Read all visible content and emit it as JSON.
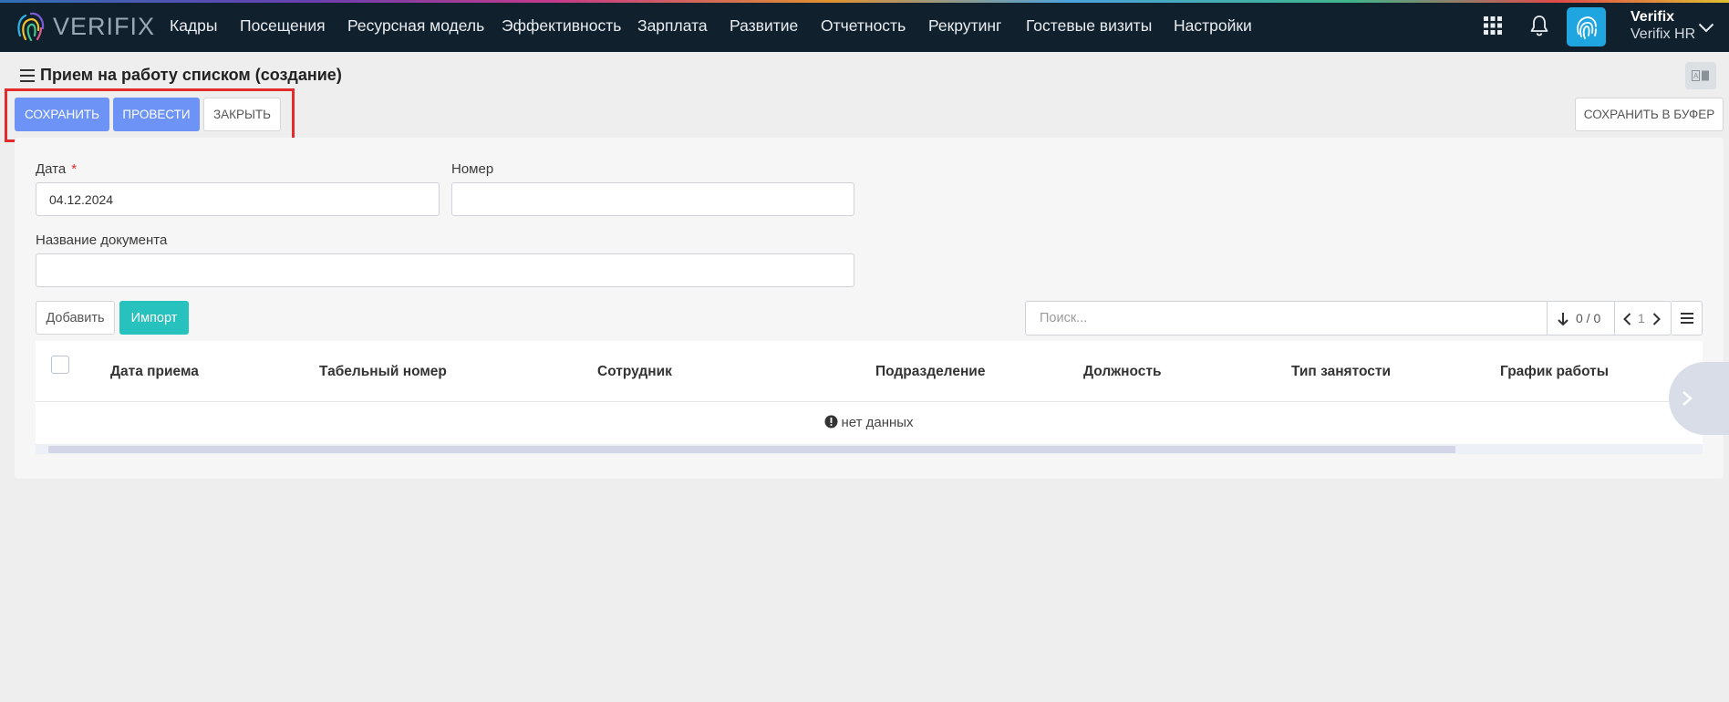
{
  "app": {
    "brand": "VERIFIX",
    "menu": [
      "Кадры",
      "Посещения",
      "Ресурсная модель",
      "Эффективность",
      "Зарплата",
      "Развитие",
      "Отчетность",
      "Рекрутинг",
      "Гостевые визиты",
      "Настройки"
    ],
    "user": {
      "name": "Verifix",
      "company": "Verifix HR"
    }
  },
  "page": {
    "title": "Прием на работу списком (создание)",
    "lang_badge": "A▣"
  },
  "toolbar": {
    "save": "СОХРАНИТЬ",
    "post": "ПРОВЕСТИ",
    "close": "ЗАКРЫТЬ",
    "save_buffer": "СОХРАНИТЬ В БУФЕР"
  },
  "form": {
    "date_label": "Дата",
    "date_required": "*",
    "date_value": "04.12.2024",
    "number_label": "Номер",
    "number_value": "",
    "docname_label": "Название документа",
    "docname_value": ""
  },
  "grid": {
    "add": "Добавить",
    "import": "Импорт",
    "search_placeholder": "Поиск...",
    "count": "0 / 0",
    "page": "1",
    "columns": [
      "Дата приема",
      "Табельный номер",
      "Сотрудник",
      "Подразделение",
      "Должность",
      "Тип занятости",
      "График работы"
    ],
    "empty_text": "нет данных"
  },
  "colors": {
    "nav_bg": "#10202d",
    "primary": "#6c93f5",
    "teal": "#27c2bd",
    "highlight": "#e32b2b"
  }
}
